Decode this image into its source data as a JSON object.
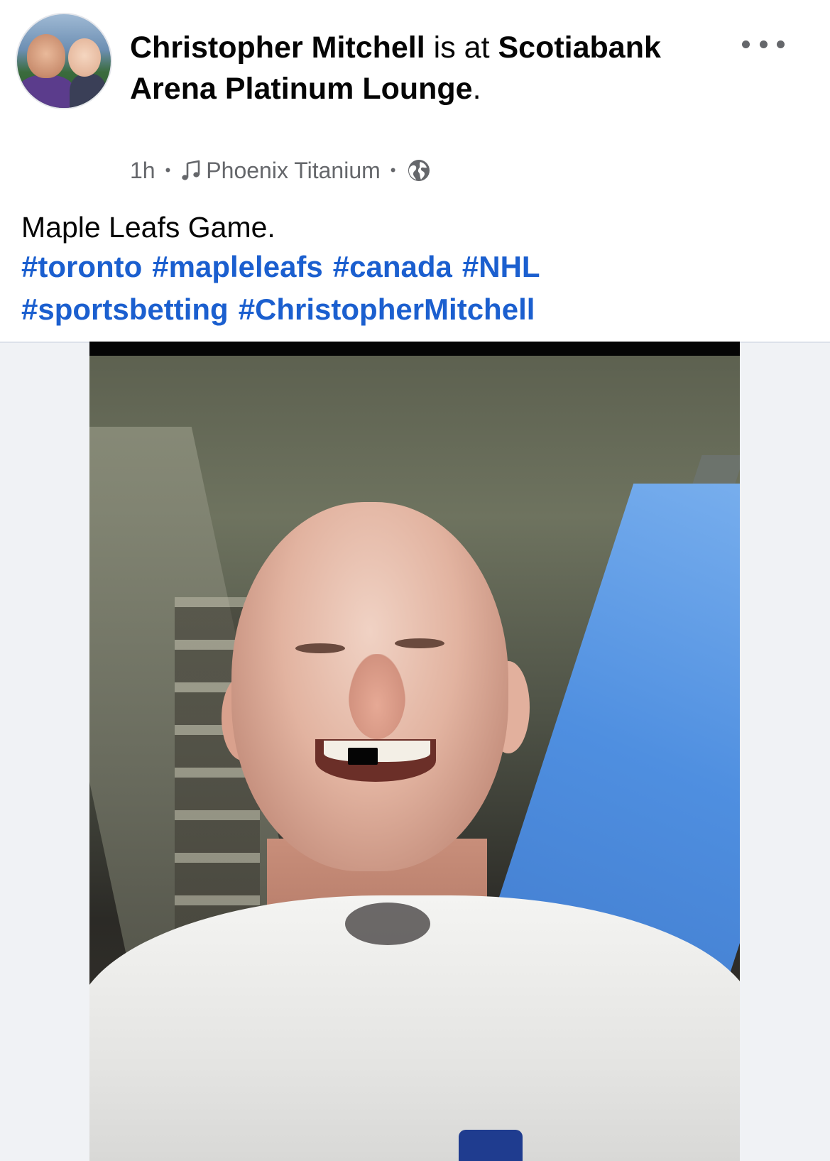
{
  "post": {
    "author_name": "Christopher Mitchell",
    "is_at_text": " is at ",
    "location_name": "Scotiabank Arena Platinum Lounge",
    "location_suffix": ".",
    "time": "1h",
    "music_title": "Phoenix Titanium",
    "audience_icon": "globe-icon",
    "music_icon": "music-note-icon",
    "more_icon": "more-options-icon",
    "caption": "Maple Leafs Game.",
    "hashtags": [
      "#toronto",
      "#mapleleafs",
      "#canada",
      "#NHL",
      "#sportsbetting",
      "#ChristopherMitchell"
    ],
    "link_color": "#1b5fcf",
    "meta_color": "#65676b"
  }
}
